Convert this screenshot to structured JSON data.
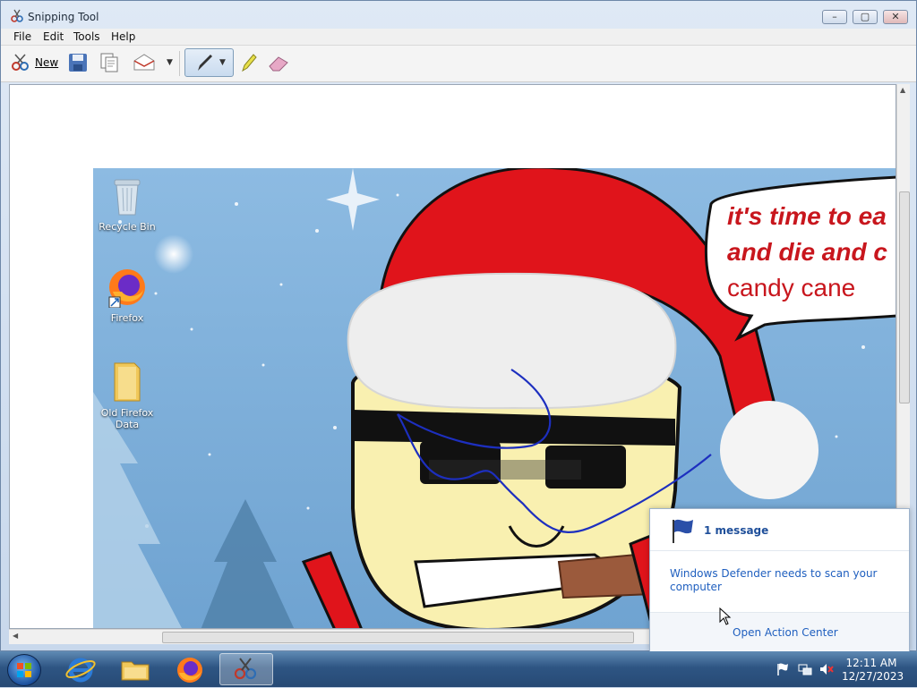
{
  "window": {
    "title": "Snipping Tool",
    "menu": [
      "File",
      "Edit",
      "Tools",
      "Help"
    ],
    "toolbar": {
      "new_label": "New"
    }
  },
  "desktop_icons": [
    {
      "label": "Recycle Bin"
    },
    {
      "label": "Firefox"
    },
    {
      "label": "Old Firefox Data"
    }
  ],
  "speech_bubble": {
    "lines": [
      "it's time to ea",
      "and die and c",
      "candy cane"
    ]
  },
  "notification": {
    "title": "1 message",
    "message": "Windows Defender needs to scan your computer",
    "action": "Open Action Center"
  },
  "taskbar": {
    "time": "12:11 AM",
    "date": "12/27/2023"
  },
  "colors": {
    "accent": "#1f5fbf",
    "santa_red": "#e0141b",
    "sky": "#7fb0dc"
  }
}
